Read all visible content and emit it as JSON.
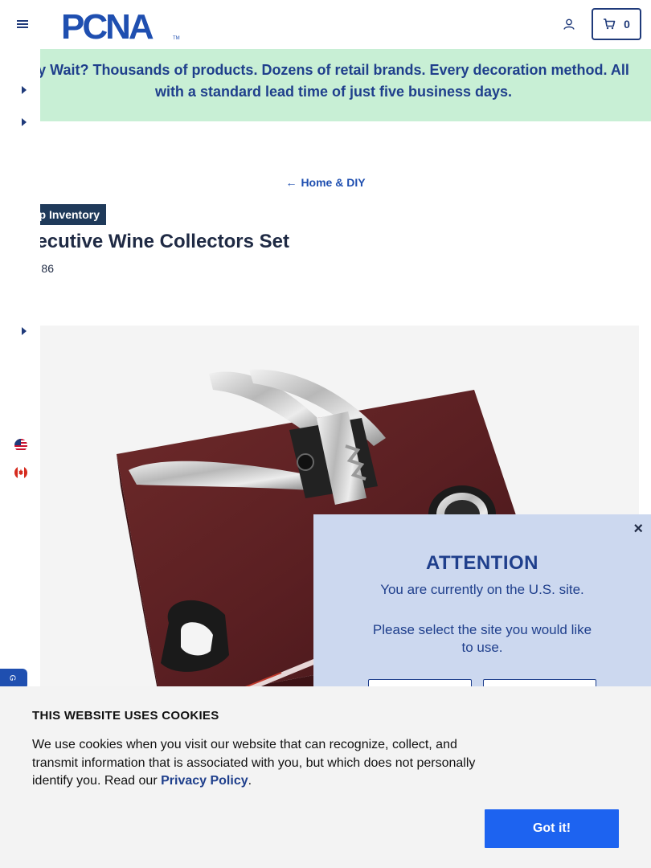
{
  "header": {
    "logo_text": "PCNA",
    "logo_tm": "TM",
    "cart_count": "0"
  },
  "promo": {
    "text_line1": "y Wait? Thousands of products. Dozens of retail brands. Every decoration method. All",
    "text_line2": "with a standard lead time of just five business days."
  },
  "breadcrumb": {
    "arrow": "←",
    "label": "Home & DIY"
  },
  "product": {
    "badge": "p Inventory",
    "title": "ecutive Wine Collectors Set",
    "sku": "86"
  },
  "modal": {
    "close": "×",
    "title": "ATTENTION",
    "line1": "You are currently on the U.S. site.",
    "line2": "Please select the site you would like to use."
  },
  "feedback_tab": {
    "text": "G"
  },
  "cookie": {
    "title": "THIS WEBSITE USES COOKIES",
    "text": "We use cookies when you visit our website that can recognize, collect, and transmit information that is associated with you, but which does not personally identify you. Read our ",
    "link": "Privacy Policy",
    "period": ".",
    "button": "Got it!"
  },
  "colors": {
    "brand_blue": "#1f4fb0",
    "promo_bg": "#c8efd5",
    "modal_bg": "#ccd8ef",
    "cookie_button": "#1d63f0",
    "badge_bg": "#1f3a5a"
  },
  "icons": [
    "menu-icon",
    "user-icon",
    "cart-icon",
    "caret-right-icon",
    "us-flag-icon",
    "canada-flag-icon",
    "arrow-left-icon",
    "close-icon"
  ]
}
